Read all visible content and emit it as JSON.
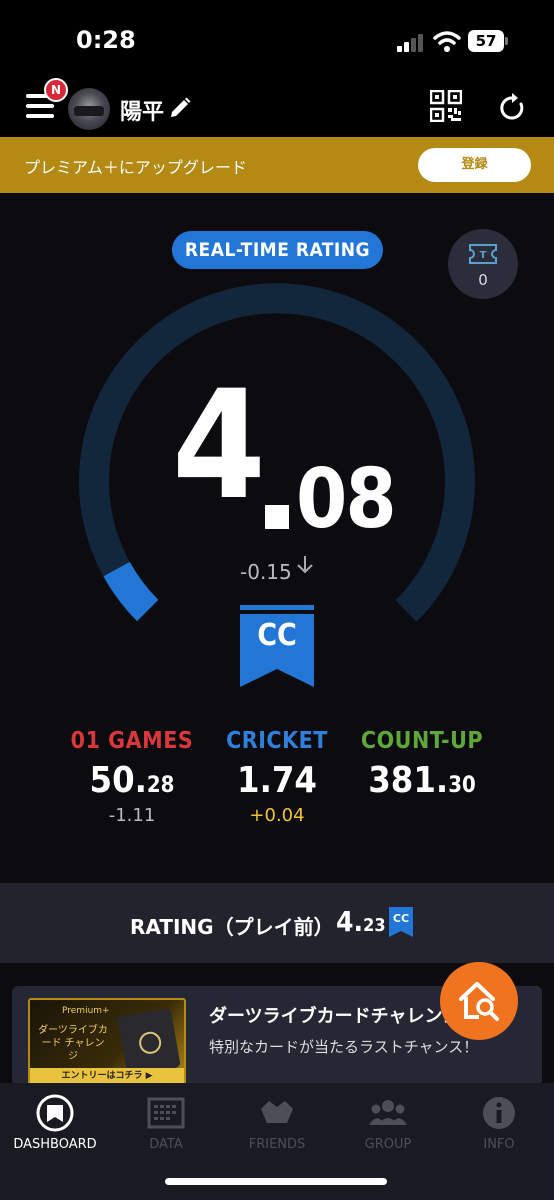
{
  "status_bar": {
    "time": "0:28",
    "battery": "57"
  },
  "header": {
    "notification_badge": "N",
    "username": "陽平"
  },
  "premium": {
    "text": "プレミアム＋にアップグレード",
    "button": "登録",
    "color": "#b58a14"
  },
  "rating": {
    "pill_label": "REAL-TIME RATING",
    "ticket_count": "0",
    "integer": "4",
    "decimal": "08",
    "delta": "-0.15",
    "class_label": "CC",
    "gauge_fraction": 0.06,
    "accent": "#2276d6"
  },
  "stats": [
    {
      "name": "01 GAMES",
      "int": "50.",
      "dec": "28",
      "delta": "-1.11",
      "color": "#d8383a",
      "delta_color": "#bbbbbb"
    },
    {
      "name": "CRICKET",
      "int": "1.74",
      "dec": "",
      "delta": "+0.04",
      "color": "#2e80dc",
      "delta_color": "#f3c232"
    },
    {
      "name": "COUNT-UP",
      "int": "381.",
      "dec": "30",
      "delta": "",
      "color": "#5ea83a",
      "delta_color": "#bbbbbb"
    }
  ],
  "rating_before": {
    "label": "RATING（プレイ前）",
    "int": "4.",
    "dec": "23",
    "class_label": "CC"
  },
  "promo": {
    "title": "ダーツライブカードチャレンジ",
    "subtitle": "特別なカードが当たるラストチャンス！",
    "image_tag": "Premium+",
    "image_title": "ダーツライブカード チャレンジ",
    "image_cta": "エントリーはコチラ ▶"
  },
  "tabs": [
    {
      "label": "DASHBOARD",
      "icon": "dashboard-icon",
      "active": true
    },
    {
      "label": "DATA",
      "icon": "data-icon",
      "active": false
    },
    {
      "label": "FRIENDS",
      "icon": "friends-icon",
      "active": false
    },
    {
      "label": "GROUP",
      "icon": "group-icon",
      "active": false
    },
    {
      "label": "INFO",
      "icon": "info-icon",
      "active": false
    }
  ]
}
